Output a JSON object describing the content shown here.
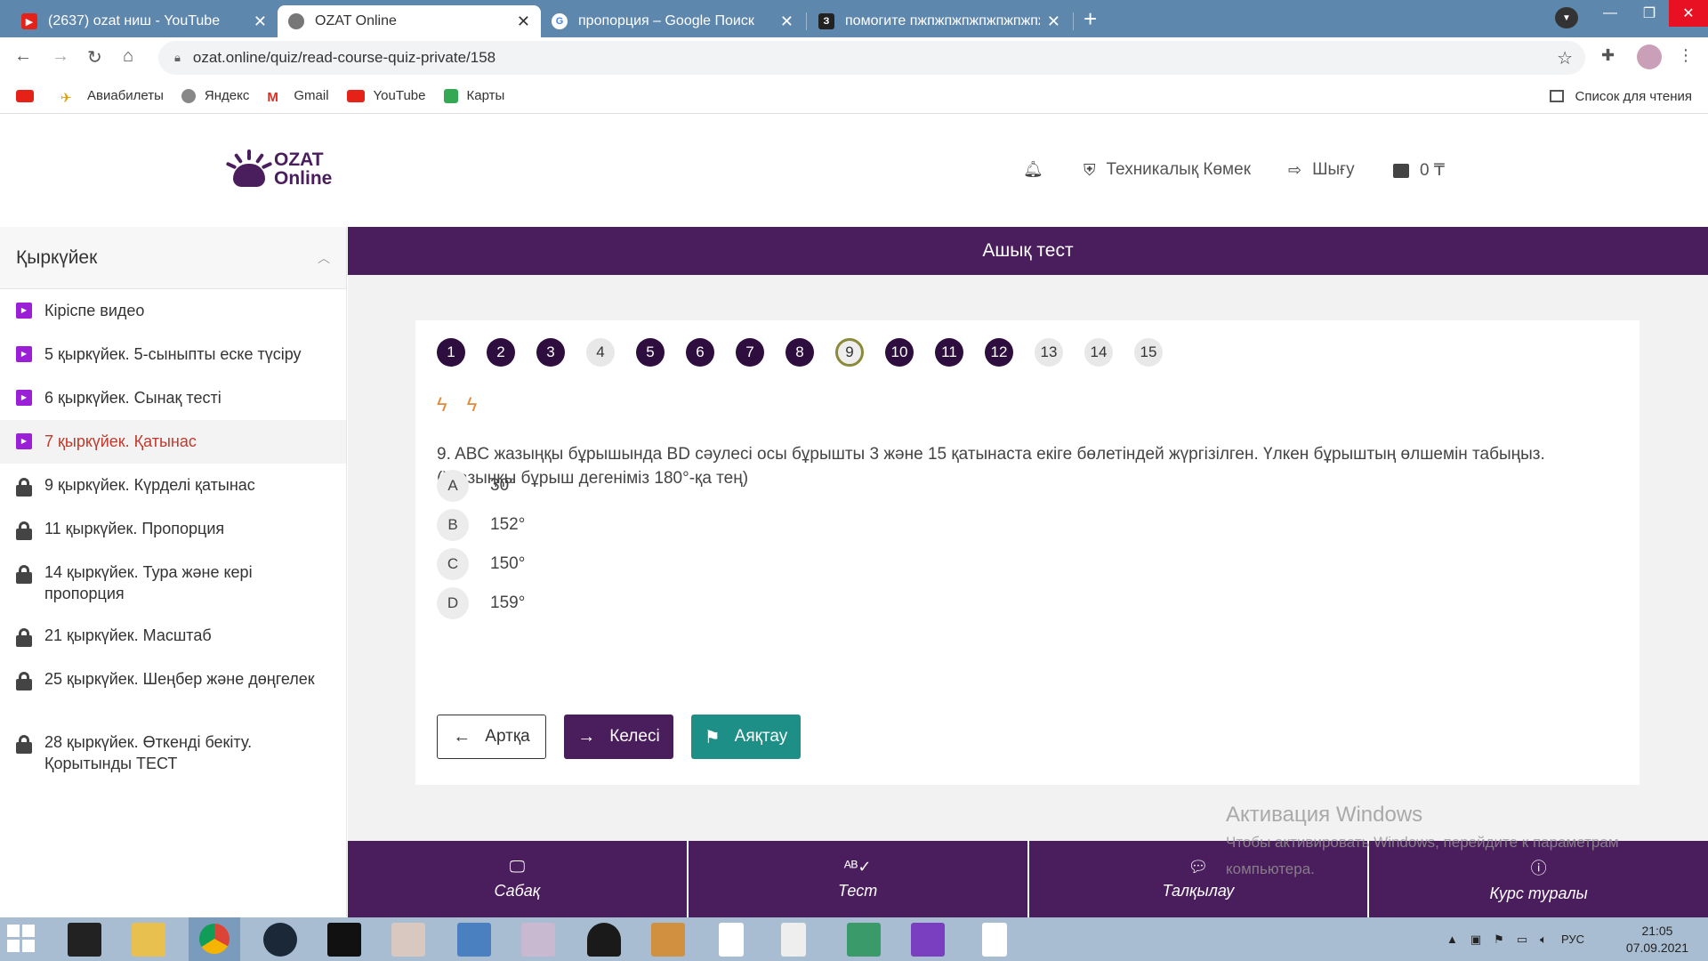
{
  "browser": {
    "tabs": [
      {
        "title": "(2637) ozat ниш - YouTube",
        "active": false,
        "favicon": "youtube-icon"
      },
      {
        "title": "OZAT Online",
        "active": true,
        "favicon": "globe-icon"
      },
      {
        "title": "пропорция – Google Поиск",
        "active": false,
        "favicon": "google-icon"
      },
      {
        "title": "помогите пжпжпжпжпжпжпжпжпжпжпжпжпж",
        "active": false,
        "favicon": "znanija-icon"
      }
    ],
    "url": "ozat.online/quiz/read-course-quiz-private/158",
    "bookmarks": [
      "Авиабилеты",
      "Яндекс",
      "Gmail",
      "YouTube",
      "Карты"
    ],
    "reading_list": "Список для чтения"
  },
  "site": {
    "logo_line1": "OZAT",
    "logo_line2": "Online",
    "support": "Техникалық Көмек",
    "logout": "Шығу",
    "balance": "0 ₸"
  },
  "sidebar": {
    "title": "Қыркүйек",
    "items": [
      {
        "label": "Кіріспе видео",
        "icon": "play-icon",
        "locked": false,
        "active": false
      },
      {
        "label": "5 қыркүйек. 5-сыныпты еске түсіру",
        "icon": "play-icon",
        "locked": false,
        "active": false
      },
      {
        "label": "6 қыркүйек. Сынақ тесті",
        "icon": "play-icon",
        "locked": false,
        "active": false
      },
      {
        "label": "7 қыркүйек. Қатынас",
        "icon": "play-icon",
        "locked": false,
        "active": true
      },
      {
        "label": "9 қыркүйек. Күрделі қатынас",
        "icon": "lock-icon",
        "locked": true,
        "active": false
      },
      {
        "label": "11 қыркүйек. Пропорция",
        "icon": "lock-icon",
        "locked": true,
        "active": false
      },
      {
        "label": "14 қыркүйек. Тура және кері пропорция",
        "icon": "lock-icon",
        "locked": true,
        "active": false
      },
      {
        "label": "21 қыркүйек. Масштаб",
        "icon": "lock-icon",
        "locked": true,
        "active": false
      },
      {
        "label": "25 қыркүйек. Шеңбер және дөңгелек",
        "icon": "lock-icon",
        "locked": true,
        "active": false
      },
      {
        "label": "28 қыркүйек. Өткенді бекіту. Қорытынды ТЕСТ",
        "icon": "lock-icon",
        "locked": true,
        "active": false
      }
    ]
  },
  "quiz": {
    "header": "Ашық тест",
    "questions": [
      {
        "n": "1",
        "state": "answered"
      },
      {
        "n": "2",
        "state": "answered"
      },
      {
        "n": "3",
        "state": "answered"
      },
      {
        "n": "4",
        "state": "empty"
      },
      {
        "n": "5",
        "state": "answered"
      },
      {
        "n": "6",
        "state": "answered"
      },
      {
        "n": "7",
        "state": "answered"
      },
      {
        "n": "8",
        "state": "answered"
      },
      {
        "n": "9",
        "state": "current"
      },
      {
        "n": "10",
        "state": "answered"
      },
      {
        "n": "11",
        "state": "answered"
      },
      {
        "n": "12",
        "state": "answered"
      },
      {
        "n": "13",
        "state": "empty"
      },
      {
        "n": "14",
        "state": "empty"
      },
      {
        "n": "15",
        "state": "empty"
      }
    ],
    "question_text": "9. ABC жазыңқы бұрышында BD сәулесі осы бұрышты 3 және 15 қатынаста екіге бөлетіндей жүргізілген. Үлкен бұрыштың өлшемін табыңыз. (Жазыңқы бұрыш дегеніміз 180°-қа тең)",
    "options": [
      {
        "letter": "A",
        "text": "30°"
      },
      {
        "letter": "B",
        "text": "152°"
      },
      {
        "letter": "C",
        "text": "150°"
      },
      {
        "letter": "D",
        "text": "159°"
      }
    ],
    "btn_back": "Артқа",
    "btn_next": "Келесі",
    "btn_finish": "Аяқтау"
  },
  "bottom_nav": [
    {
      "label": "Сабақ",
      "icon": "monitor-icon"
    },
    {
      "label": "Тест",
      "icon": "spellcheck-icon"
    },
    {
      "label": "Талқылау",
      "icon": "chat-icon"
    },
    {
      "label": "Курс туралы",
      "icon": "info-icon"
    }
  ],
  "watermark": {
    "title": "Активация Windows",
    "line1": "Чтобы активировать Windows, перейдите к параметрам",
    "line2": "компьютера."
  },
  "taskbar": {
    "lang": "РУС",
    "time": "21:05",
    "date": "07.09.2021"
  },
  "colors": {
    "brand_purple": "#4a1d5c",
    "finish_teal": "#1e8f86",
    "active_red": "#c0392b"
  }
}
